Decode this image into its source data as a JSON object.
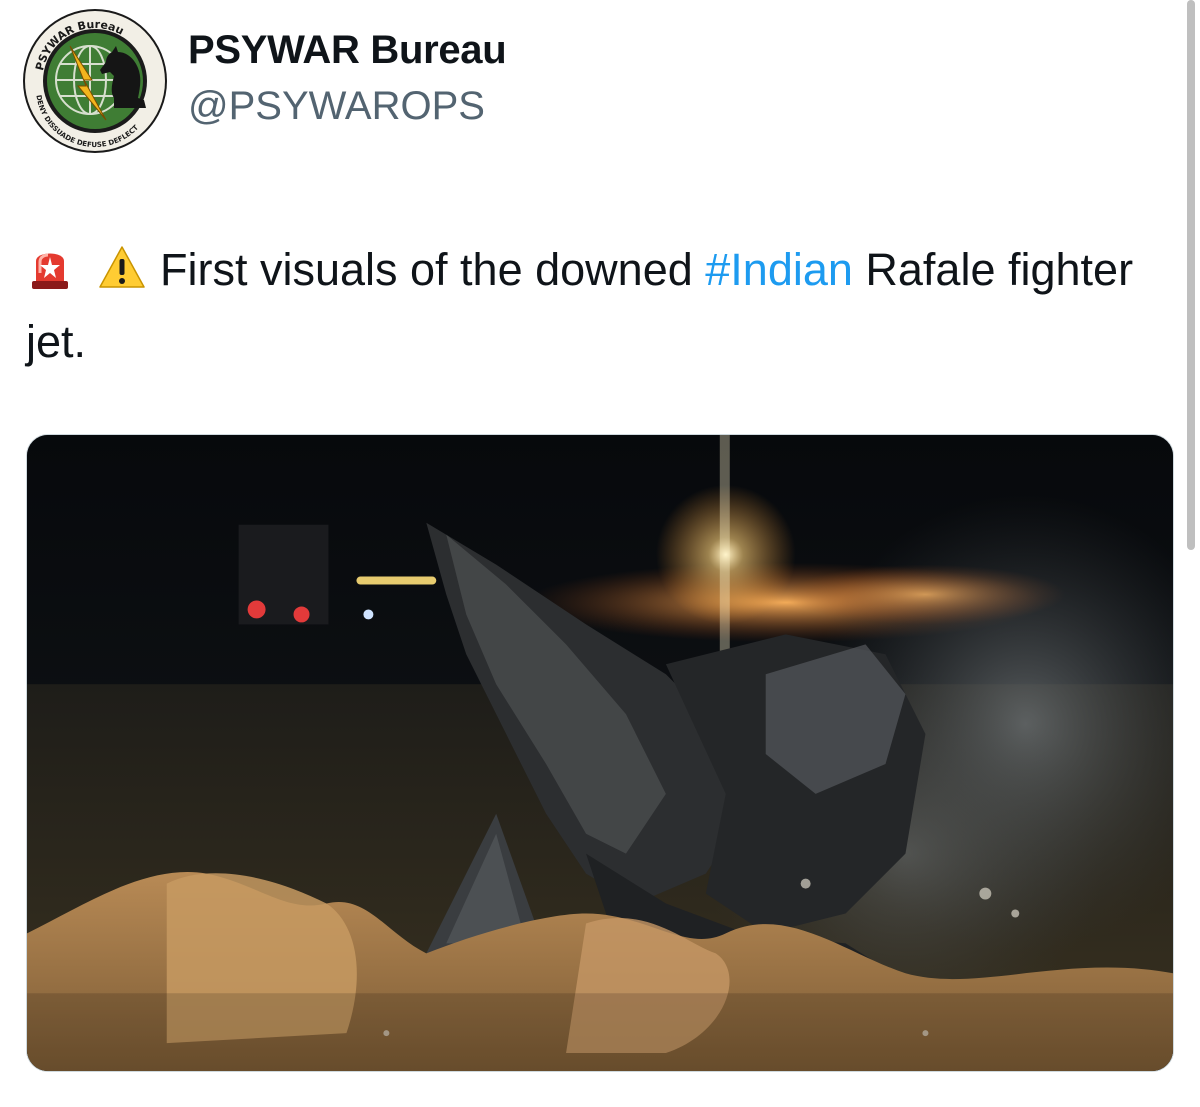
{
  "author": {
    "display_name": "PSYWAR Bureau",
    "handle": "@PSYWAROPS",
    "avatar": {
      "icon": "psywar-bureau-logo",
      "ring_text_top": "PSYWAR Bureau",
      "ring_text_bottom": "DENY · DISSUADE · DEFUSE · DEFLECT"
    }
  },
  "tweet": {
    "emojis": [
      "police-car-light-emoji",
      "warning-emoji"
    ],
    "text_before_hashtag": "First visuals of the downed ",
    "hashtag": "#Indian",
    "text_after_hashtag": " Rafale fighter jet."
  },
  "media": {
    "type": "photo",
    "icon": "crash-site-photo"
  },
  "colors": {
    "hashtag": "#1d9bf0",
    "handle": "#536471",
    "text": "#0f1419",
    "logo_green": "#2e6b2f"
  }
}
